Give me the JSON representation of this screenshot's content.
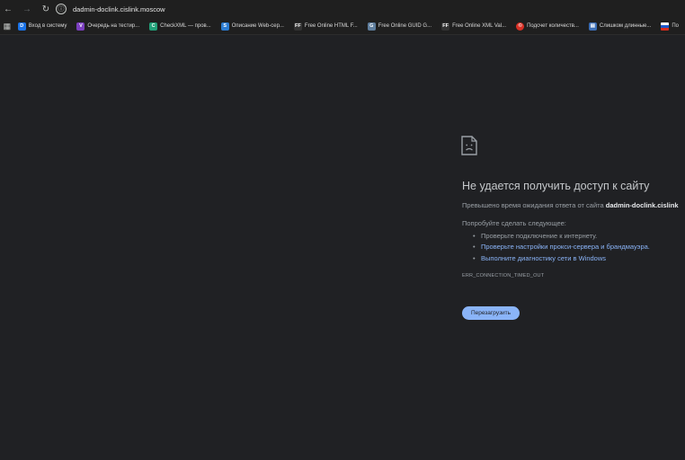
{
  "browser": {
    "url": "dadmin-doclink.cislink.moscow",
    "bookmarks": [
      {
        "label": "Вход в систему",
        "icon": "D",
        "color": "#1a73e8"
      },
      {
        "label": "Очередь на тестир...",
        "icon": "V",
        "color": "#7b3fbf"
      },
      {
        "label": "CheckXML — пров...",
        "icon": "C",
        "color": "#21a179"
      },
      {
        "label": "Описание Web-сер...",
        "icon": "S",
        "color": "#2b7cd3"
      },
      {
        "label": "Free Online HTML F...",
        "icon": "FF",
        "color": "#333333"
      },
      {
        "label": "Free Online GUID G...",
        "icon": "G",
        "color": "#5f7e9e"
      },
      {
        "label": "Free Online XML Val...",
        "icon": "FF",
        "color": "#333333"
      },
      {
        "label": "Подсчет количеств...",
        "icon": "©",
        "color": "#d93025"
      },
      {
        "label": "Слишком длинные...",
        "icon": "▤",
        "color": "#3d6fb6"
      },
      {
        "label": "По",
        "icon": "",
        "color": "#ffffff"
      }
    ]
  },
  "error": {
    "title": "Не удается получить доступ к сайту",
    "description_prefix": "Превышено время ожидания ответа от сайта ",
    "description_host": "dadmin-doclink.cislink",
    "try_label": "Попробуйте сделать следующее:",
    "suggestions": [
      "Проверьте подключение к интернету.",
      "Проверьте настройки прокси-сервера и брандмауэра.",
      "Выполните диагностику сети в Windows"
    ],
    "code": "ERR_CONNECTION_TIMED_OUT",
    "reload_label": "Перезагрузить"
  },
  "colors": {
    "background": "#202124",
    "link": "#8ab4f8",
    "button": "#8ab4f8"
  }
}
